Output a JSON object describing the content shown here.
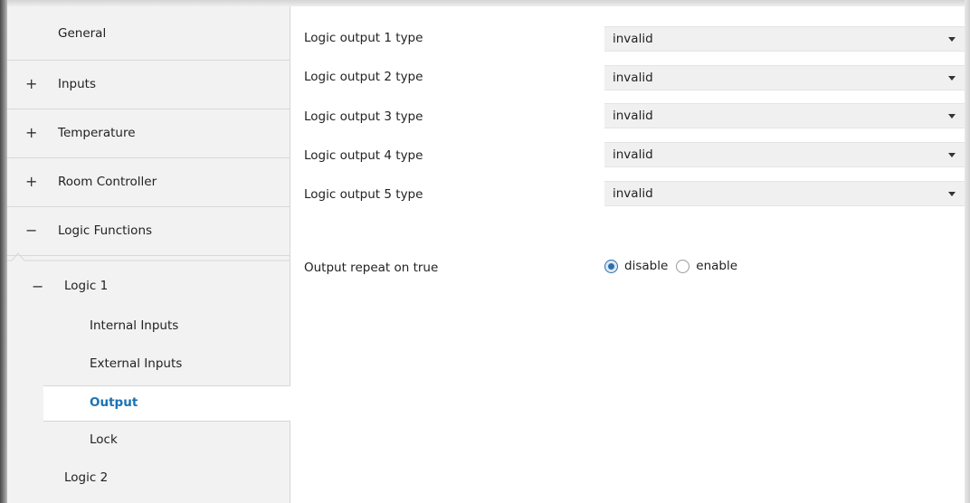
{
  "sidebar": {
    "items": [
      {
        "sign": "",
        "label": "General"
      },
      {
        "sign": "+",
        "label": "Inputs"
      },
      {
        "sign": "+",
        "label": "Temperature"
      },
      {
        "sign": "+",
        "label": "Room Controller"
      },
      {
        "sign": "−",
        "label": "Logic Functions"
      },
      {
        "sign": "−",
        "label": "Logic 1"
      },
      {
        "sign": "",
        "label": "Internal Inputs"
      },
      {
        "sign": "",
        "label": "External Inputs"
      },
      {
        "sign": "",
        "label": "Output"
      },
      {
        "sign": "",
        "label": "Lock"
      },
      {
        "sign": "",
        "label": "Logic 2"
      }
    ],
    "selected": "Output"
  },
  "main": {
    "outputs": [
      {
        "label": "Logic output 1 type",
        "value": "invalid"
      },
      {
        "label": "Logic output 2 type",
        "value": "invalid"
      },
      {
        "label": "Logic output 3 type",
        "value": "invalid"
      },
      {
        "label": "Logic output 4 type",
        "value": "invalid"
      },
      {
        "label": "Logic output 5 type",
        "value": "invalid"
      }
    ],
    "repeat": {
      "label": "Output repeat on true",
      "options": [
        "disable",
        "enable"
      ],
      "selected": "disable"
    }
  },
  "colors": {
    "sidebar_bg": "#f2f2f2",
    "selected_text": "#1a73b5",
    "select_bg": "#f0f0f0",
    "radio_accent": "#2f6ea8"
  }
}
